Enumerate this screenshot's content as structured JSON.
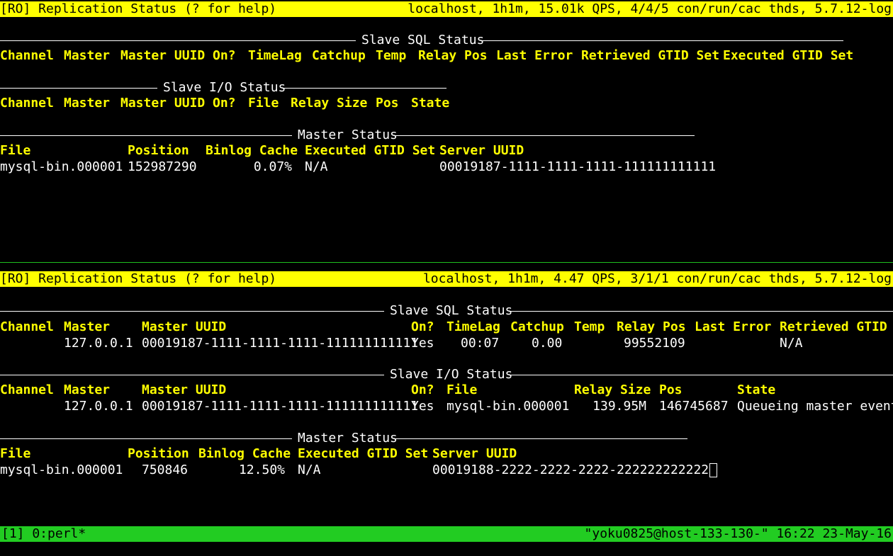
{
  "pane1": {
    "header_left": "[RO] Replication Status (? for help)",
    "header_right": "localhost, 1h1m, 15.01k QPS, 4/4/5 con/run/cac thds, 5.7.12-log",
    "slave_sql_title": "Slave SQL Status",
    "slave_sql_cols": [
      "Channel",
      "Master",
      "Master UUID",
      "On?",
      "TimeLag",
      "Catchup",
      "Temp",
      "Relay Pos",
      "Last Error",
      "Retrieved GTID Set",
      "Executed GTID Set"
    ],
    "slave_io_title": "Slave I/O Status",
    "slave_io_cols": [
      "Channel",
      "Master",
      "Master UUID",
      "On?",
      "File",
      "Relay Size",
      "Pos",
      "State"
    ],
    "master_title": "Master Status",
    "master_cols": [
      "File",
      "Position",
      "Binlog Cache",
      "Executed GTID Set",
      "Server UUID"
    ],
    "master_row": [
      "mysql-bin.000001",
      "152987290",
      "0.07%",
      "N/A",
      "00019187-1111-1111-1111-111111111111"
    ]
  },
  "pane2": {
    "header_left": "[RO] Replication Status (? for help)",
    "header_right": "localhost, 1h1m, 4.47 QPS, 3/1/1 con/run/cac thds, 5.7.12-log",
    "slave_sql_title": "Slave SQL Status",
    "slave_sql_cols": [
      "Channel",
      "Master",
      "Master UUID",
      "On?",
      "TimeLag",
      "Catchup",
      "Temp",
      "Relay Pos",
      "Last Error",
      "Retrieved GTID S"
    ],
    "slave_sql_row": [
      "127.0.0.1",
      "00019187-1111-1111-1111-111111111111",
      "Yes",
      "00:07",
      "0.00",
      "99552109",
      "N/A"
    ],
    "slave_io_title": "Slave I/O Status",
    "slave_io_cols": [
      "Channel",
      "Master",
      "Master UUID",
      "On?",
      "File",
      "Relay Size",
      "Pos",
      "State"
    ],
    "slave_io_row": [
      "127.0.0.1",
      "00019187-1111-1111-1111-111111111111",
      "Yes",
      "mysql-bin.000001",
      "139.95M",
      "146745687",
      "Queueing master event"
    ],
    "master_title": "Master Status",
    "master_cols": [
      "File",
      "Position",
      "Binlog Cache",
      "Executed GTID Set",
      "Server UUID"
    ],
    "master_row": [
      "mysql-bin.000001",
      "750846",
      "12.50%",
      "N/A",
      "00019188-2222-2222-2222-222222222222"
    ]
  },
  "statusbar": {
    "left": "[1] 0:perl*",
    "right": "\"yoku0825@host-133-130-\" 16:22 23-May-16"
  },
  "colors": {
    "header_bg": "#ffff00",
    "column_fg": "#ffff00",
    "statusbar_bg": "#22cc22",
    "separator": "#1fbf1f"
  }
}
